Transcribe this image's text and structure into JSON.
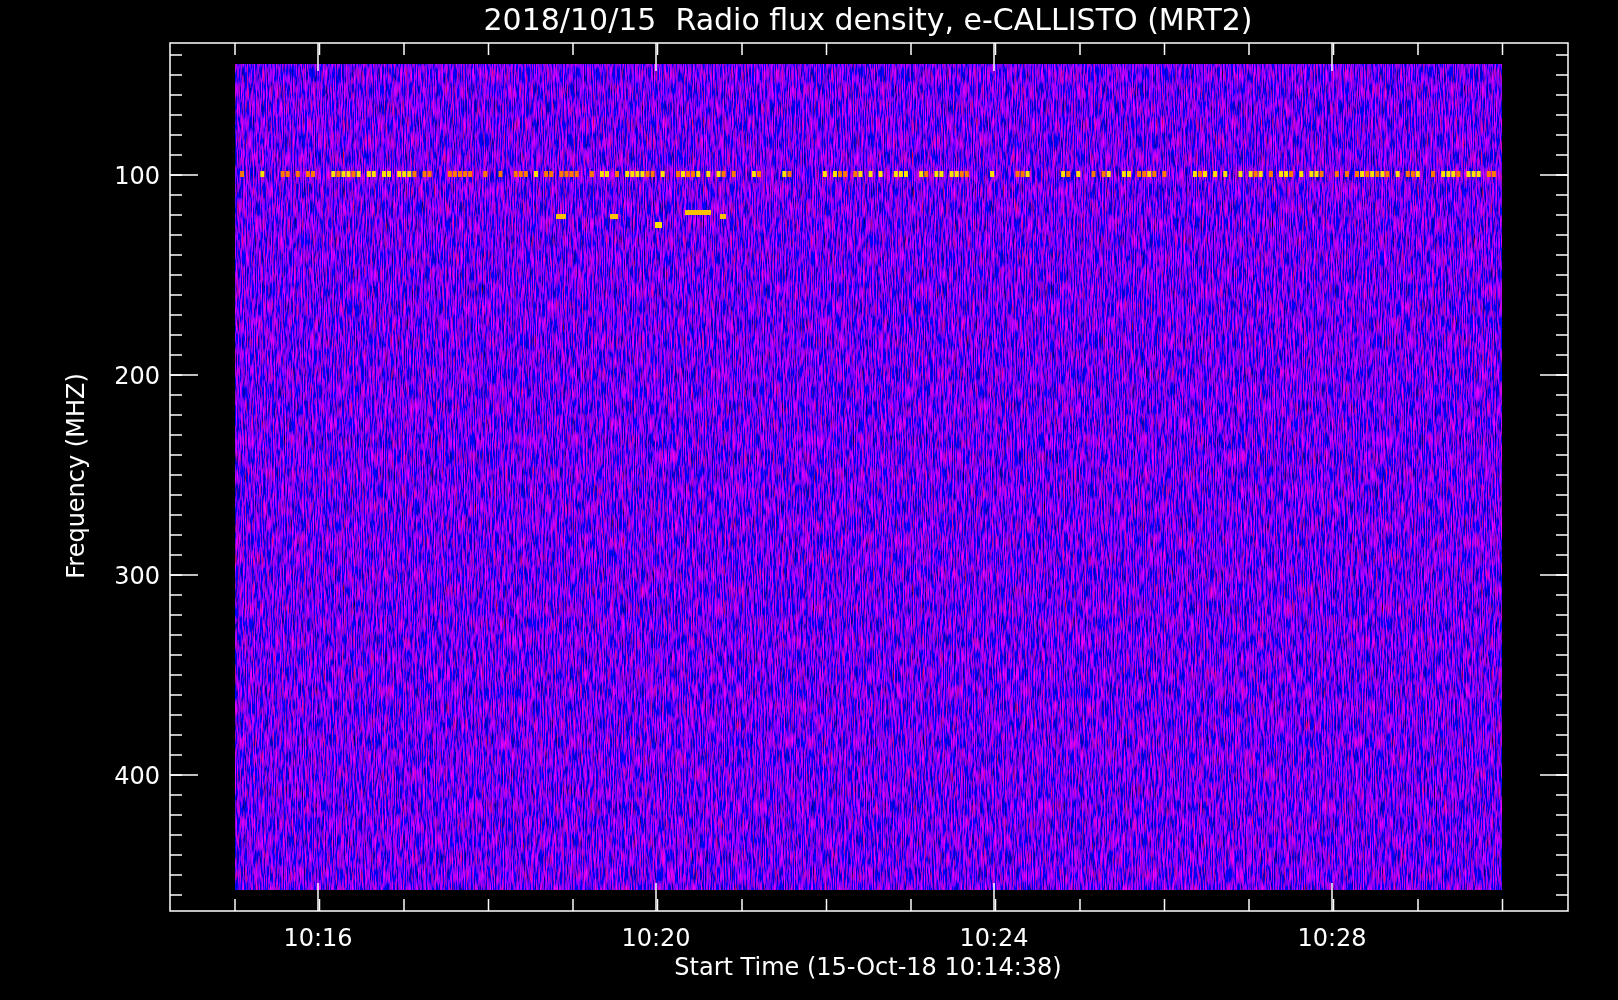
{
  "title": "2018/10/15  Radio flux density, e-CALLISTO (MRT2)",
  "y_axis": {
    "label": "Frequency (MHZ)",
    "tick_labels": [
      "100",
      "200",
      "300",
      "400"
    ]
  },
  "x_axis": {
    "label": "Start Time (15-Oct-18 10:14:38)",
    "tick_labels": [
      "10:16",
      "10:20",
      "10:24",
      "10:28"
    ]
  }
}
